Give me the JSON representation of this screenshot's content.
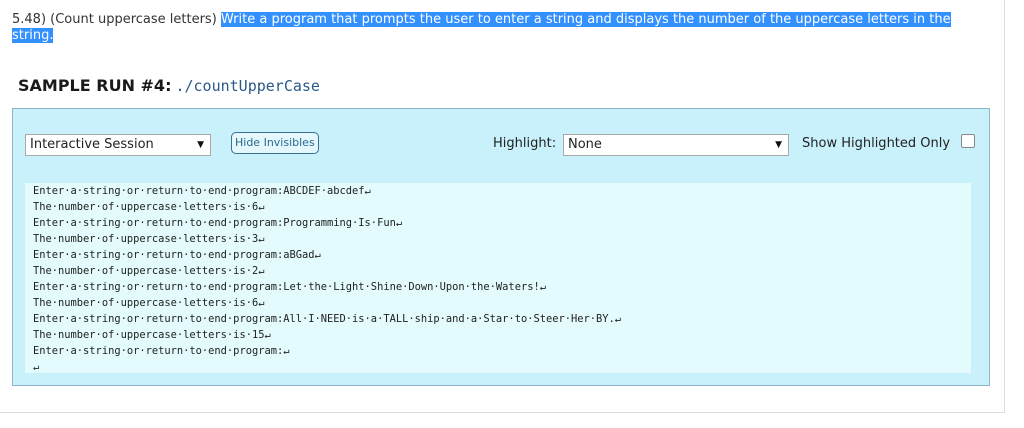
{
  "problem": {
    "prefix": "5.48) (Count uppercase letters) ",
    "highlighted": "Write a program that prompts the user to enter a string and displays the number of the uppercase letters in the string."
  },
  "sample": {
    "title": "SAMPLE RUN #4:",
    "command": "./countUpperCase"
  },
  "toolbar": {
    "session_select": "Interactive Session",
    "hide_button": "Hide Invisibles",
    "highlight_label": "Highlight:",
    "highlight_select": "None",
    "show_label": "Show Highlighted Only"
  },
  "session": {
    "lines": [
      "Enter·a·string·or·return·to·end·program:ABCDEF·abcdef↵",
      "The·number·of·uppercase·letters·is·6↵",
      "Enter·a·string·or·return·to·end·program:Programming·Is·Fun↵",
      "The·number·of·uppercase·letters·is·3↵",
      "Enter·a·string·or·return·to·end·program:aBGad↵",
      "The·number·of·uppercase·letters·is·2↵",
      "Enter·a·string·or·return·to·end·program:Let·the·Light·Shine·Down·Upon·the·Waters!↵",
      "The·number·of·uppercase·letters·is·6↵",
      "Enter·a·string·or·return·to·end·program:All·I·NEED·is·a·TALL·ship·and·a·Star·to·Steer·Her·BY.↵",
      "The·number·of·uppercase·letters·is·15↵",
      "Enter·a·string·or·return·to·end·program:↵",
      "↵"
    ]
  }
}
